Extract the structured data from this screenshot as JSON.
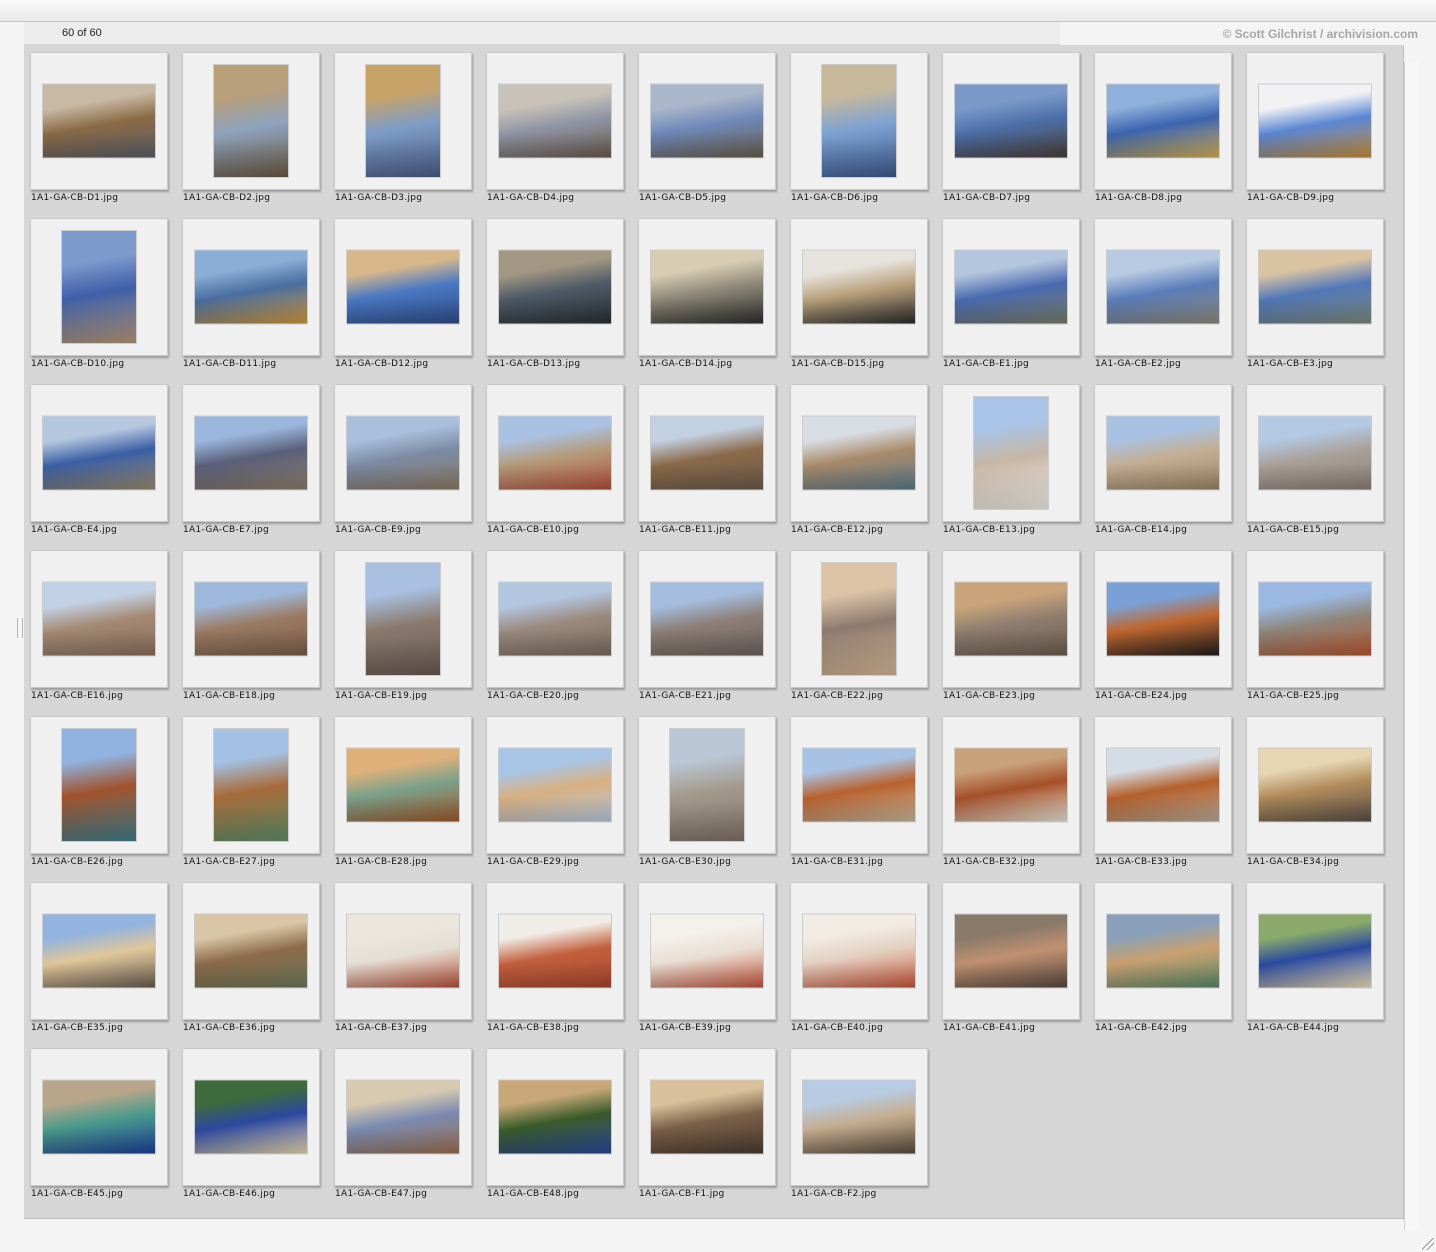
{
  "header": {
    "count": "60 of 60",
    "credit": "© Scott Gilchrist / archivision.com"
  },
  "thumbnails": [
    {
      "filename": "1A1-GA-CB-D1.jpg",
      "orientation": "landscape",
      "colors": [
        "#c8b9a4",
        "#8a6a45",
        "#5b5e6a"
      ]
    },
    {
      "filename": "1A1-GA-CB-D2.jpg",
      "orientation": "portrait",
      "colors": [
        "#b8a07a",
        "#8ea3bd",
        "#6c5a45"
      ]
    },
    {
      "filename": "1A1-GA-CB-D3.jpg",
      "orientation": "portrait",
      "colors": [
        "#c7a36a",
        "#7d9cc6",
        "#4b5e86"
      ]
    },
    {
      "filename": "1A1-GA-CB-D4.jpg",
      "orientation": "landscape",
      "colors": [
        "#c9c2b8",
        "#8f95a6",
        "#6b5b4e"
      ]
    },
    {
      "filename": "1A1-GA-CB-D5.jpg",
      "orientation": "landscape",
      "colors": [
        "#aab6c9",
        "#6e88b8",
        "#6a5f4d"
      ]
    },
    {
      "filename": "1A1-GA-CB-D6.jpg",
      "orientation": "portrait",
      "colors": [
        "#c7b89c",
        "#7ea2d1",
        "#3d5a90"
      ]
    },
    {
      "filename": "1A1-GA-CB-D7.jpg",
      "orientation": "landscape",
      "colors": [
        "#7a99c9",
        "#4c6fa8",
        "#4a4038"
      ]
    },
    {
      "filename": "1A1-GA-CB-D8.jpg",
      "orientation": "landscape",
      "colors": [
        "#8fb0db",
        "#3b65b0",
        "#d7b055"
      ]
    },
    {
      "filename": "1A1-GA-CB-D9.jpg",
      "orientation": "landscape",
      "colors": [
        "#f2f2f4",
        "#5b86d3",
        "#c98f3a"
      ]
    },
    {
      "filename": "1A1-GA-CB-D10.jpg",
      "orientation": "portrait",
      "colors": [
        "#7e99cc",
        "#3f5fa8",
        "#b79a7a"
      ]
    },
    {
      "filename": "1A1-GA-CB-D11.jpg",
      "orientation": "landscape",
      "colors": [
        "#8aaed5",
        "#4a6e9f",
        "#d39a3c"
      ]
    },
    {
      "filename": "1A1-GA-CB-D12.jpg",
      "orientation": "landscape",
      "colors": [
        "#d7b78a",
        "#4a78c3",
        "#2f4d8a"
      ]
    },
    {
      "filename": "1A1-GA-CB-D13.jpg",
      "orientation": "landscape",
      "colors": [
        "#a29783",
        "#4e5a66",
        "#2a2f33"
      ]
    },
    {
      "filename": "1A1-GA-CB-D14.jpg",
      "orientation": "landscape",
      "colors": [
        "#d8cdb3",
        "#8e8878",
        "#2d2d2d"
      ]
    },
    {
      "filename": "1A1-GA-CB-D15.jpg",
      "orientation": "landscape",
      "colors": [
        "#e6e3dc",
        "#b9a17c",
        "#2b2b2b"
      ]
    },
    {
      "filename": "1A1-GA-CB-E1.jpg",
      "orientation": "landscape",
      "colors": [
        "#b4c6dd",
        "#4a6ab0",
        "#7a7d68"
      ]
    },
    {
      "filename": "1A1-GA-CB-E2.jpg",
      "orientation": "landscape",
      "colors": [
        "#b7cae1",
        "#5a7cb8",
        "#8e8c7d"
      ]
    },
    {
      "filename": "1A1-GA-CB-E3.jpg",
      "orientation": "landscape",
      "colors": [
        "#d9c3a2",
        "#5277b8",
        "#7d8a7a"
      ]
    },
    {
      "filename": "1A1-GA-CB-E4.jpg",
      "orientation": "landscape",
      "colors": [
        "#b6c8e0",
        "#3b5fa4",
        "#9a8b6e"
      ]
    },
    {
      "filename": "1A1-GA-CB-E7.jpg",
      "orientation": "landscape",
      "colors": [
        "#9ab6dc",
        "#5a5f7a",
        "#8e7f6a"
      ]
    },
    {
      "filename": "1A1-GA-CB-E9.jpg",
      "orientation": "landscape",
      "colors": [
        "#a9bfdc",
        "#7b8aa3",
        "#8c7a63"
      ]
    },
    {
      "filename": "1A1-GA-CB-E10.jpg",
      "orientation": "landscape",
      "colors": [
        "#a9c2e4",
        "#b49a7a",
        "#b5503a"
      ]
    },
    {
      "filename": "1A1-GA-CB-E11.jpg",
      "orientation": "landscape",
      "colors": [
        "#c2d0e2",
        "#8a6a4a",
        "#6c5a4a"
      ]
    },
    {
      "filename": "1A1-GA-CB-E12.jpg",
      "orientation": "landscape",
      "colors": [
        "#d8dde4",
        "#a88a6a",
        "#5c7a8a"
      ]
    },
    {
      "filename": "1A1-GA-CB-E13.jpg",
      "orientation": "portrait",
      "colors": [
        "#a9c4e6",
        "#c7b6a5",
        "#f2eee8"
      ]
    },
    {
      "filename": "1A1-GA-CB-E14.jpg",
      "orientation": "landscape",
      "colors": [
        "#a9c2e3",
        "#c3ae93",
        "#9e8468"
      ]
    },
    {
      "filename": "1A1-GA-CB-E15.jpg",
      "orientation": "landscape",
      "colors": [
        "#b3c9e4",
        "#a9a099",
        "#8b7f74"
      ]
    },
    {
      "filename": "1A1-GA-CB-E16.jpg",
      "orientation": "landscape",
      "colors": [
        "#c2d2e6",
        "#a48a74",
        "#8a6e5a"
      ]
    },
    {
      "filename": "1A1-GA-CB-E18.jpg",
      "orientation": "landscape",
      "colors": [
        "#9eb8dc",
        "#9a7a62",
        "#7a5e4a"
      ]
    },
    {
      "filename": "1A1-GA-CB-E19.jpg",
      "orientation": "portrait",
      "colors": [
        "#a9c0e0",
        "#8a7a6e",
        "#6a5a52"
      ]
    },
    {
      "filename": "1A1-GA-CB-E20.jpg",
      "orientation": "landscape",
      "colors": [
        "#b2c6e0",
        "#9a8a7e",
        "#7a6a5e"
      ]
    },
    {
      "filename": "1A1-GA-CB-E21.jpg",
      "orientation": "landscape",
      "colors": [
        "#a4bcde",
        "#8c7f77",
        "#6b625d"
      ]
    },
    {
      "filename": "1A1-GA-CB-E22.jpg",
      "orientation": "portrait",
      "colors": [
        "#dcc3a6",
        "#8c7a6e",
        "#d8b898"
      ]
    },
    {
      "filename": "1A1-GA-CB-E23.jpg",
      "orientation": "landscape",
      "colors": [
        "#c9a47a",
        "#8e7d6f",
        "#6c5c50"
      ]
    },
    {
      "filename": "1A1-GA-CB-E24.jpg",
      "orientation": "landscape",
      "colors": [
        "#7aa0d6",
        "#c0662e",
        "#1e1e1e"
      ]
    },
    {
      "filename": "1A1-GA-CB-E25.jpg",
      "orientation": "landscape",
      "colors": [
        "#9ab8e2",
        "#8e8579",
        "#b8562e"
      ]
    },
    {
      "filename": "1A1-GA-CB-E26.jpg",
      "orientation": "portrait",
      "colors": [
        "#8fb2de",
        "#a0522d",
        "#3f7f8c"
      ]
    },
    {
      "filename": "1A1-GA-CB-E27.jpg",
      "orientation": "portrait",
      "colors": [
        "#a4c0e3",
        "#a66a3a",
        "#5f8f6a"
      ]
    },
    {
      "filename": "1A1-GA-CB-E28.jpg",
      "orientation": "landscape",
      "colors": [
        "#e0b07a",
        "#7aa08a",
        "#a0582a"
      ]
    },
    {
      "filename": "1A1-GA-CB-E29.jpg",
      "orientation": "landscape",
      "colors": [
        "#a9c5e6",
        "#d8b080",
        "#b6c9e0"
      ]
    },
    {
      "filename": "1A1-GA-CB-E30.jpg",
      "orientation": "portrait",
      "colors": [
        "#b9c7d6",
        "#a49a8c",
        "#7e7266"
      ]
    },
    {
      "filename": "1A1-GA-CB-E31.jpg",
      "orientation": "landscape",
      "colors": [
        "#a8c2e3",
        "#b8622e",
        "#c9b89e"
      ]
    },
    {
      "filename": "1A1-GA-CB-E32.jpg",
      "orientation": "landscape",
      "colors": [
        "#c8a07a",
        "#a55028",
        "#e8e2d6"
      ]
    },
    {
      "filename": "1A1-GA-CB-E33.jpg",
      "orientation": "landscape",
      "colors": [
        "#d4dce6",
        "#b5602c",
        "#b8ab98"
      ]
    },
    {
      "filename": "1A1-GA-CB-E34.jpg",
      "orientation": "landscape",
      "colors": [
        "#e6d6b4",
        "#b08a5a",
        "#5a5048"
      ]
    },
    {
      "filename": "1A1-GA-CB-E35.jpg",
      "orientation": "landscape",
      "colors": [
        "#92b4de",
        "#e0c79a",
        "#6b5e52"
      ]
    },
    {
      "filename": "1A1-GA-CB-E36.jpg",
      "orientation": "landscape",
      "colors": [
        "#d8c6a6",
        "#8c6a4a",
        "#6e7a5a"
      ]
    },
    {
      "filename": "1A1-GA-CB-E37.jpg",
      "orientation": "landscape",
      "colors": [
        "#ece6dc",
        "#e4ded4",
        "#b8523a"
      ]
    },
    {
      "filename": "1A1-GA-CB-E38.jpg",
      "orientation": "landscape",
      "colors": [
        "#f0ece6",
        "#c2603e",
        "#a8462c"
      ]
    },
    {
      "filename": "1A1-GA-CB-E39.jpg",
      "orientation": "landscape",
      "colors": [
        "#f4f0ea",
        "#e8ded4",
        "#c4563c"
      ]
    },
    {
      "filename": "1A1-GA-CB-E40.jpg",
      "orientation": "landscape",
      "colors": [
        "#f2ebe4",
        "#e2cfc0",
        "#c8553a"
      ]
    },
    {
      "filename": "1A1-GA-CB-E41.jpg",
      "orientation": "landscape",
      "colors": [
        "#8a7a6a",
        "#c09070",
        "#5a4a40"
      ]
    },
    {
      "filename": "1A1-GA-CB-E42.jpg",
      "orientation": "landscape",
      "colors": [
        "#8aa0b8",
        "#c9a070",
        "#5b8a6a"
      ]
    },
    {
      "filename": "1A1-GA-CB-E44.jpg",
      "orientation": "landscape",
      "colors": [
        "#8aa96a",
        "#2a4aa0",
        "#efe0b8"
      ]
    },
    {
      "filename": "1A1-GA-CB-E45.jpg",
      "orientation": "landscape",
      "colors": [
        "#b8a58a",
        "#4a9a8a",
        "#1d3f9a"
      ]
    },
    {
      "filename": "1A1-GA-CB-E46.jpg",
      "orientation": "landscape",
      "colors": [
        "#3e6a3e",
        "#2c48a0",
        "#ead8b0"
      ]
    },
    {
      "filename": "1A1-GA-CB-E47.jpg",
      "orientation": "landscape",
      "colors": [
        "#d8cab0",
        "#7a8ab0",
        "#9a7050"
      ]
    },
    {
      "filename": "1A1-GA-CB-E48.jpg",
      "orientation": "landscape",
      "colors": [
        "#c8a878",
        "#3a5a2a",
        "#2a4a9a"
      ]
    },
    {
      "filename": "1A1-GA-CB-F1.jpg",
      "orientation": "landscape",
      "colors": [
        "#d8c09a",
        "#7a6048",
        "#4a3a2e"
      ]
    },
    {
      "filename": "1A1-GA-CB-F2.jpg",
      "orientation": "landscape",
      "colors": [
        "#b8cbe2",
        "#c4ad8e",
        "#5a4a3e"
      ]
    }
  ]
}
